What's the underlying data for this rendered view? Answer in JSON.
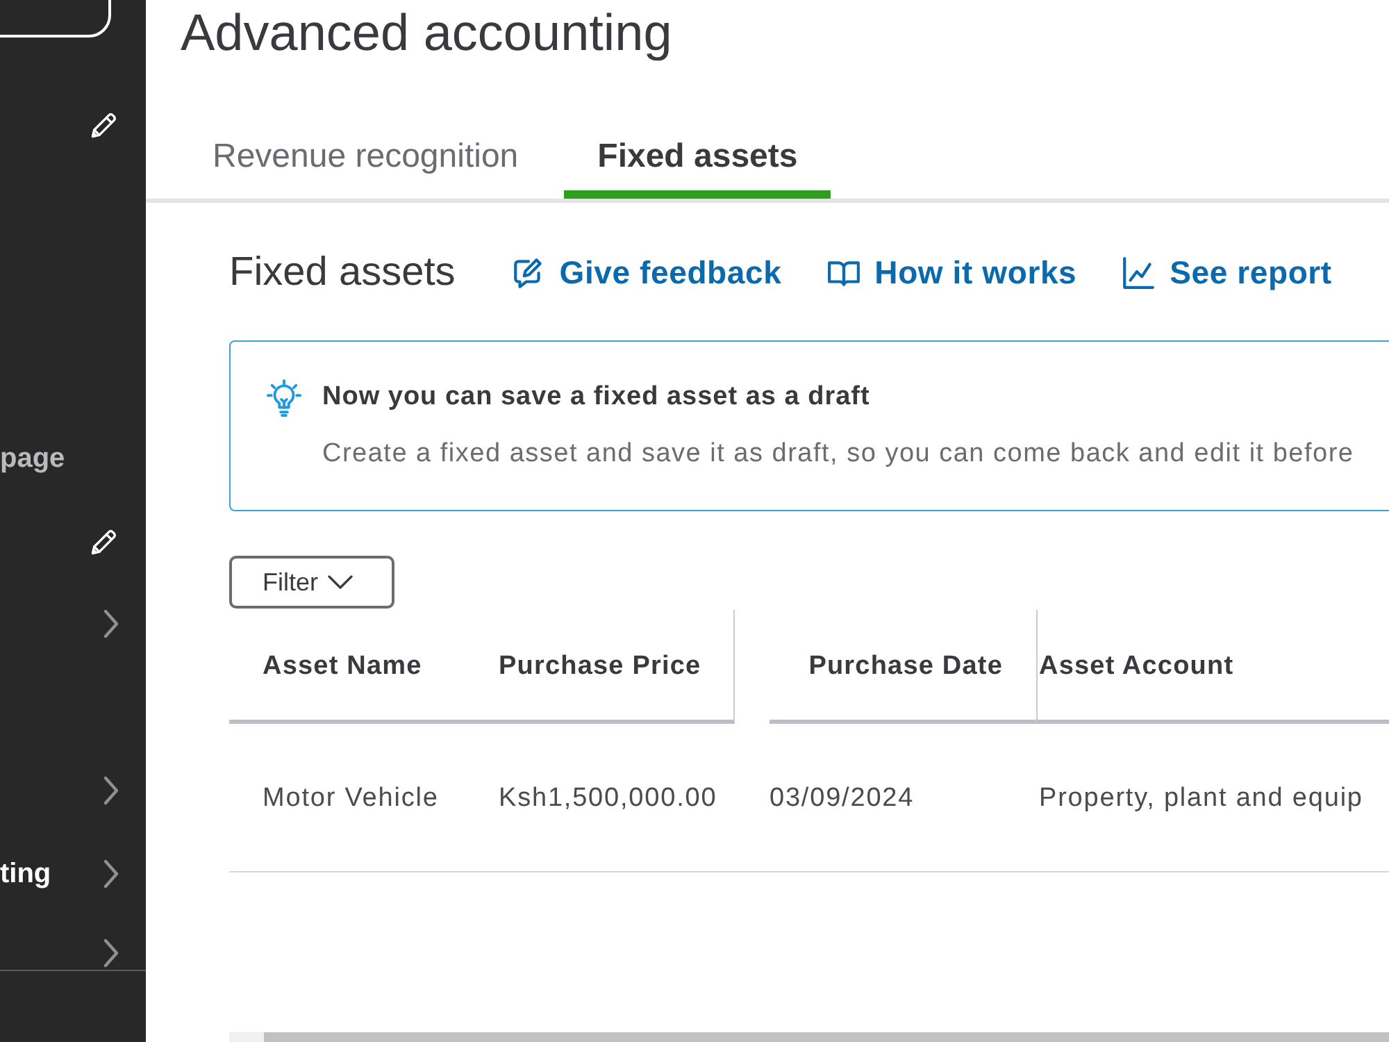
{
  "sidebar": {
    "items": [
      {
        "kind": "edit",
        "selected": false
      },
      {
        "kind": "link",
        "label": "page",
        "selected": false
      },
      {
        "kind": "edit",
        "selected": false
      },
      {
        "kind": "expand",
        "selected": false
      },
      {
        "kind": "expand",
        "selected": false
      },
      {
        "kind": "expand",
        "label": "ting",
        "selected": true
      },
      {
        "kind": "expand",
        "selected": false
      }
    ]
  },
  "page_title": "Advanced accounting",
  "tabs": [
    {
      "label": "Revenue recognition",
      "selected": false
    },
    {
      "label": "Fixed assets",
      "selected": true
    }
  ],
  "section": {
    "title": "Fixed assets",
    "links": [
      {
        "kind": "feedback",
        "label": "Give feedback"
      },
      {
        "kind": "guide",
        "label": "How it works"
      },
      {
        "kind": "report",
        "label": "See report"
      }
    ]
  },
  "notice": {
    "title": "Now you can save a fixed asset as a draft",
    "message": "Create a fixed asset and save it as draft, so you can come back and edit it before"
  },
  "filter": {
    "label": "Filter"
  },
  "table": {
    "columns": [
      "Asset Name",
      "Purchase Price",
      "Purchase Date",
      "Asset Account"
    ],
    "rows": [
      [
        "Motor Vehicle",
        "Ksh1,500,000.00",
        "03/09/2024",
        "Property, plant and equip"
      ]
    ]
  }
}
